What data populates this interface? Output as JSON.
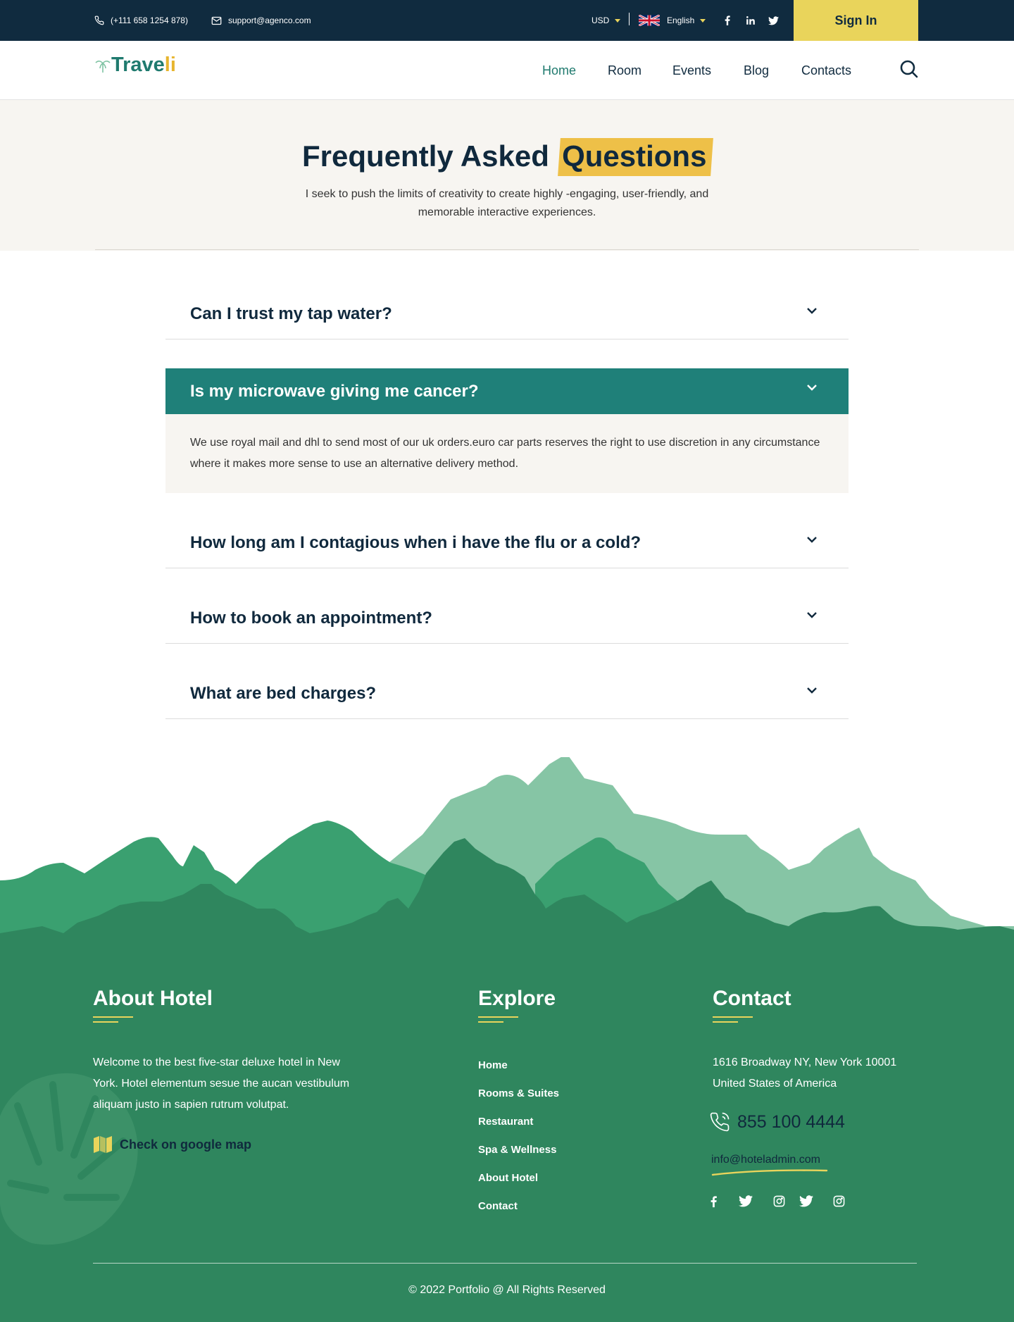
{
  "topbar": {
    "phone": "(+111 658 1254 878)",
    "email": "support@agenco.com",
    "currency": "USD",
    "language": "English",
    "social_icons": [
      "facebook-icon",
      "linkedin-icon",
      "twitter-icon"
    ],
    "sign_in": "Sign In"
  },
  "header": {
    "logo_part1": "Trave",
    "logo_part2": "li",
    "nav": [
      "Home",
      "Room",
      "Events",
      "Blog",
      "Contacts"
    ],
    "active_nav": "Home"
  },
  "hero": {
    "title_main": "Frequently Asked",
    "title_highlight": "Questions",
    "subtitle": "I seek to push the limits of creativity to create highly -engaging, user-friendly, and memorable interactive experiences."
  },
  "faq": {
    "items": [
      {
        "question": "Can I trust my tap water?",
        "open": false
      },
      {
        "question": "Is my microwave giving me cancer?",
        "open": true
      },
      {
        "question": "How long am I contagious when i have the flu or a cold?",
        "open": false
      },
      {
        "question": "How to book an appointment?",
        "open": false
      },
      {
        "question": "What are bed charges?",
        "open": false
      }
    ],
    "open_answer": "We use royal mail and dhl to send most of our uk orders.euro car parts reserves the right to use discretion in any circumstance where it makes more sense to use an alternative delivery method."
  },
  "footer": {
    "about": {
      "heading": "About Hotel",
      "text": "Welcome to the best five-star deluxe hotel in New York. Hotel elementum sesue the aucan vestibulum aliquam justo in sapien rutrum volutpat.",
      "map_link": "Check on google map"
    },
    "explore": {
      "heading": "Explore",
      "links": [
        "Home",
        "Rooms & Suites",
        "Restaurant",
        "Spa & Wellness",
        "About Hotel",
        "Contact"
      ]
    },
    "contact": {
      "heading": "Contact",
      "address_line1": "1616 Broadway NY, New York 10001",
      "address_line2": "United States of America",
      "phone": "855 100 4444",
      "email": "info@hoteladmin.com",
      "social_icons": [
        "facebook-icon",
        "twitter-icon",
        "instagram-icon",
        "twitter-icon",
        "instagram-icon"
      ]
    },
    "copyright": "© 2022 Portfolio @ All Rights Reserved"
  },
  "colors": {
    "topbar_bg": "#102b3f",
    "accent_yellow": "#e9d45b",
    "brand_teal": "#1f8079",
    "footer_green": "#2f865e",
    "hero_bg": "#f7f5f1"
  }
}
